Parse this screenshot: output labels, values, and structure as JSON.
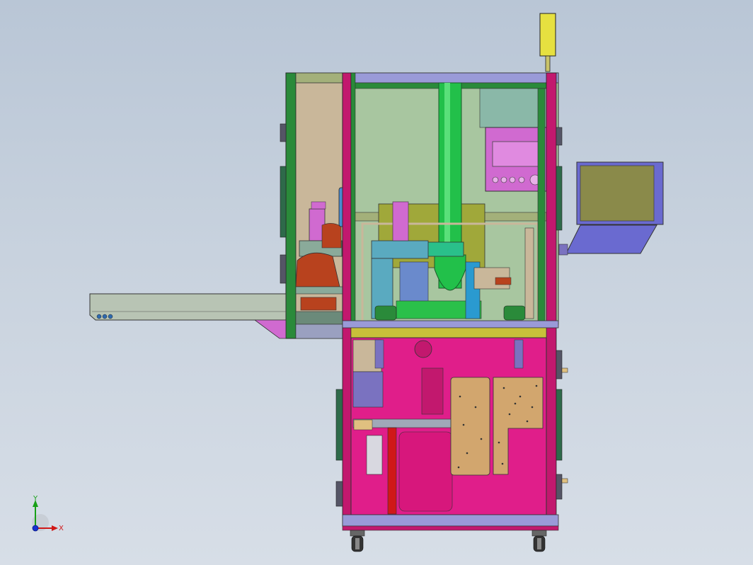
{
  "viewport": {
    "background_top": "#b9c6d6",
    "background_bottom": "#d7dee7"
  },
  "triad": {
    "x_label": "X",
    "y_label": "Y",
    "x_color": "#d01818",
    "y_color": "#18a018",
    "z_color": "#1830d0"
  },
  "colors": {
    "frame_magenta": "#c2186e",
    "frame_green": "#2a8a3a",
    "panel_tan": "#c9b79a",
    "chamber_sage": "#a8c6a0",
    "tube_green": "#22c04a",
    "hmi_pink": "#d06ad0",
    "cabinet_pink": "#e01e8a",
    "board_tan": "#d2a66e",
    "monitor_olive": "#8a8a4a",
    "monitor_frame": "#6a6ad0",
    "conveyor_gray": "#b8c4b4",
    "beacon_yellow": "#e6e040",
    "wheel_dark": "#333333"
  }
}
